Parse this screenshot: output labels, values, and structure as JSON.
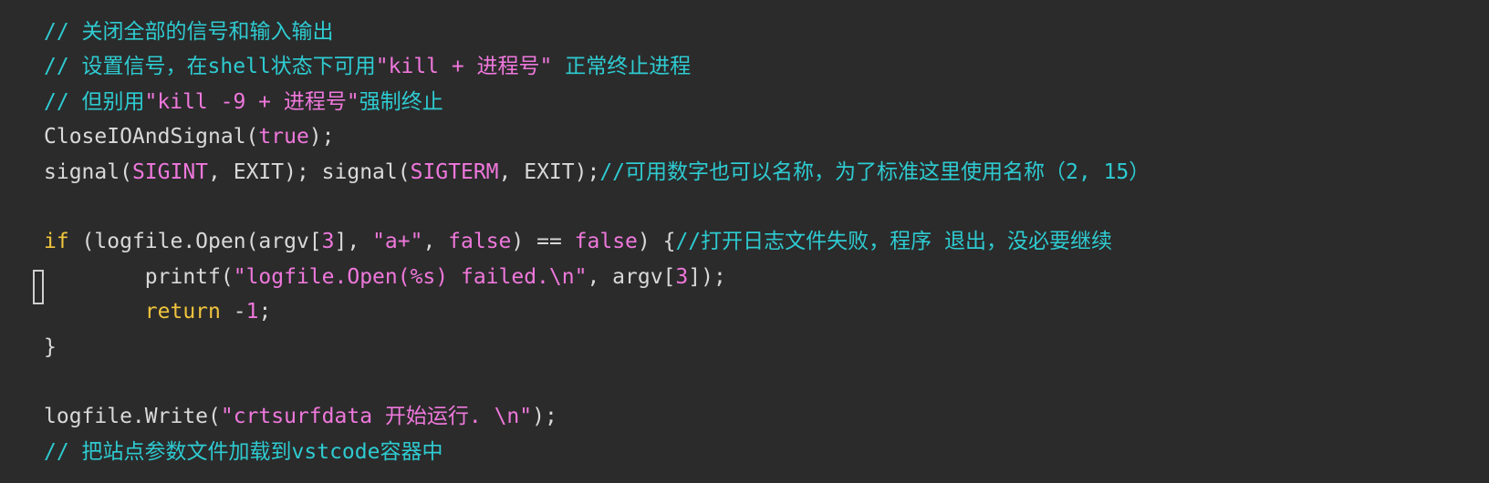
{
  "editor": {
    "lines": [
      {
        "segments": [
          {
            "text": "// 关闭全部的信号和输入输出",
            "kind": "comment"
          }
        ]
      },
      {
        "segments": [
          {
            "text": "// 设置信号，在shell状态下可用",
            "kind": "comment"
          },
          {
            "text": "\"kill + 进程号\"",
            "kind": "str"
          },
          {
            "text": " 正常终止进程",
            "kind": "comment"
          }
        ]
      },
      {
        "segments": [
          {
            "text": "// 但别用",
            "kind": "comment"
          },
          {
            "text": "\"kill -9 + 进程号\"",
            "kind": "str"
          },
          {
            "text": "强制终止",
            "kind": "comment"
          }
        ]
      },
      {
        "segments": [
          {
            "text": "CloseIOAndSignal(",
            "kind": "plain"
          },
          {
            "text": "true",
            "kind": "str"
          },
          {
            "text": ");",
            "kind": "plain"
          }
        ]
      },
      {
        "segments": [
          {
            "text": "signal(",
            "kind": "plain"
          },
          {
            "text": "SIGINT",
            "kind": "str"
          },
          {
            "text": ", EXIT); signal(",
            "kind": "plain"
          },
          {
            "text": "SIGTERM",
            "kind": "str"
          },
          {
            "text": ", EXIT);",
            "kind": "plain"
          },
          {
            "text": "//可用数字也可以名称，为了标准这里使用名称（2, 15）",
            "kind": "comment"
          }
        ]
      },
      {
        "segments": []
      },
      {
        "segments": [
          {
            "text": "if",
            "kind": "kw"
          },
          {
            "text": " (logfile.Open(argv[",
            "kind": "plain"
          },
          {
            "text": "3",
            "kind": "num"
          },
          {
            "text": "], ",
            "kind": "plain"
          },
          {
            "text": "\"a+\"",
            "kind": "str"
          },
          {
            "text": ", ",
            "kind": "plain"
          },
          {
            "text": "false",
            "kind": "str"
          },
          {
            "text": ") == ",
            "kind": "plain"
          },
          {
            "text": "false",
            "kind": "str"
          },
          {
            "text": ") {",
            "kind": "plain"
          },
          {
            "text": "//打开日志文件失败，程序 退出，没必要继续",
            "kind": "comment"
          }
        ]
      },
      {
        "segments": [
          {
            "text": "        printf(",
            "kind": "plain"
          },
          {
            "text": "\"logfile.Open(%s) failed.\\n\"",
            "kind": "str"
          },
          {
            "text": ", argv[",
            "kind": "plain"
          },
          {
            "text": "3",
            "kind": "num"
          },
          {
            "text": "]);",
            "kind": "plain"
          }
        ]
      },
      {
        "segments": [
          {
            "text": "        ",
            "kind": "plain"
          },
          {
            "text": "return",
            "kind": "kw"
          },
          {
            "text": " -",
            "kind": "plain"
          },
          {
            "text": "1",
            "kind": "num"
          },
          {
            "text": ";",
            "kind": "plain"
          }
        ]
      },
      {
        "segments": [
          {
            "text": "}",
            "kind": "plain"
          }
        ]
      },
      {
        "segments": []
      },
      {
        "segments": [
          {
            "text": "logfile.Write(",
            "kind": "plain"
          },
          {
            "text": "\"crtsurfdata 开始运行. \\n\"",
            "kind": "str"
          },
          {
            "text": ");",
            "kind": "plain"
          }
        ]
      },
      {
        "segments": [
          {
            "text": "// 把站点参数文件加载到vstcode容器中",
            "kind": "comment"
          }
        ]
      }
    ]
  }
}
